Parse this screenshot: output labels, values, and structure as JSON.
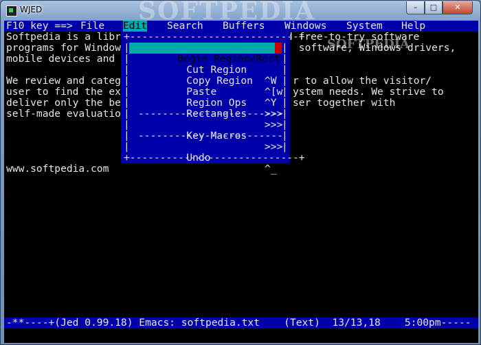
{
  "window": {
    "title": "WJED",
    "watermark": "SOFTPEDIA",
    "min_glyph": "–",
    "max_glyph": "□",
    "close_glyph": "✕"
  },
  "menubar": {
    "hint": "F10 key ==>",
    "items": [
      "File",
      "Edit",
      "Search",
      "Buffers",
      "Windows",
      "System",
      "Help"
    ],
    "active": "Edit"
  },
  "document": {
    "lines": [
      "Softpedia is a libr",
      "programs for Window",
      "mobile devices and",
      "",
      "We review and categ",
      "user to find the ex",
      "deliver only the be",
      "self-made evaluatio",
      "",
      "",
      "",
      "www.softpedia.com"
    ],
    "right_fragments": [
      "d free-to-try software",
      " software, Windows drivers,",
      "",
      "",
      "r to allow the visitor/",
      "ystem needs. We strive to",
      "ser together with"
    ],
    "overlay_watermark": "SOFTPEDIA"
  },
  "edit_menu": {
    "top_border": "+----------------------------+",
    "bottom_border": "+----------------------------+",
    "separator": "------------------------",
    "items": [
      {
        "label": "Begin Region/Rect",
        "shortcut": ""
      },
      {
        "label": "Cut Region",
        "shortcut": "^W"
      },
      {
        "label": "Copy Region",
        "shortcut": "^[w"
      },
      {
        "label": "Paste",
        "shortcut": "^Y"
      },
      {
        "label": "Region Ops",
        "shortcut": ">>>"
      },
      {
        "label": "Rectangles",
        "shortcut": ">>>"
      },
      {
        "label": "Key Macros",
        "shortcut": ">>>"
      },
      {
        "label": "Undo",
        "shortcut": "^_"
      }
    ],
    "sep_char": "|"
  },
  "statusline": {
    "text": "-**----+(Jed 0.99.18) Emacs: softpedia.txt    (Text)  13/13,18    5:00pm-----"
  },
  "colors": {
    "menubar": "#0000aa",
    "highlight": "#00aaaa",
    "text": "#e6e6e6",
    "background": "#000000"
  }
}
